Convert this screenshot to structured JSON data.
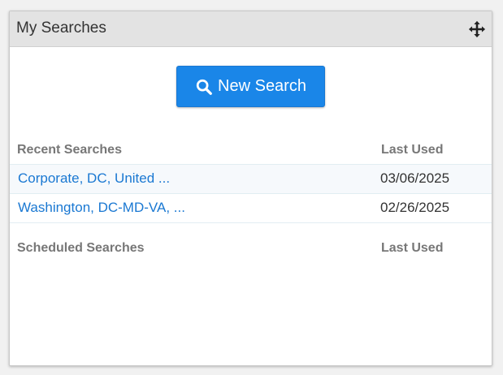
{
  "widget": {
    "title": "My Searches"
  },
  "new_search_button": {
    "label": "New Search"
  },
  "recent": {
    "header": "Recent Searches",
    "last_used_header": "Last Used",
    "rows": [
      {
        "name": "Corporate, DC, United ...",
        "date": "03/06/2025"
      },
      {
        "name": "Washington, DC-MD-VA, ...",
        "date": "02/26/2025"
      }
    ]
  },
  "scheduled": {
    "header": "Scheduled Searches",
    "last_used_header": "Last Used"
  },
  "colors": {
    "accent": "#1a86e8",
    "link": "#1a78d2",
    "header_bg": "#e3e3e3"
  },
  "icons": {
    "move": "move-icon",
    "search": "search-icon"
  }
}
